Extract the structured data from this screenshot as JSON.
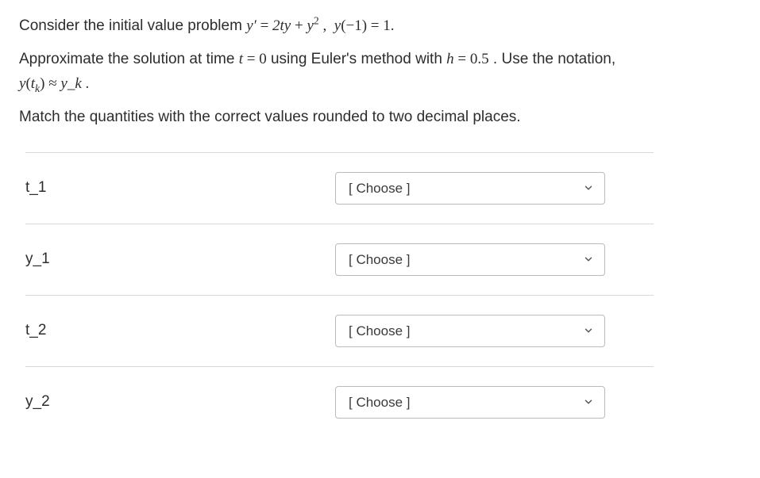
{
  "problem": {
    "line1_pre": "Consider the initial value problem ",
    "line1_eq": "y′ = 2ty + y²,  y(−1) = 1.",
    "line2_pre": "Approximate the solution at time ",
    "line2_t": "t = 0",
    "line2_mid": "  using Euler's method with ",
    "line2_h": "h = 0.5",
    "line2_post": ". Use the notation, ",
    "line3_eq": "y(t_k) ≈ y_k .",
    "line4": "Match the quantities with the correct values rounded to two decimal places."
  },
  "rows": [
    {
      "label": "t_1",
      "selected": "[ Choose ]"
    },
    {
      "label": "y_1",
      "selected": "[ Choose ]"
    },
    {
      "label": "t_2",
      "selected": "[ Choose ]"
    },
    {
      "label": "y_2",
      "selected": "[ Choose ]"
    }
  ]
}
